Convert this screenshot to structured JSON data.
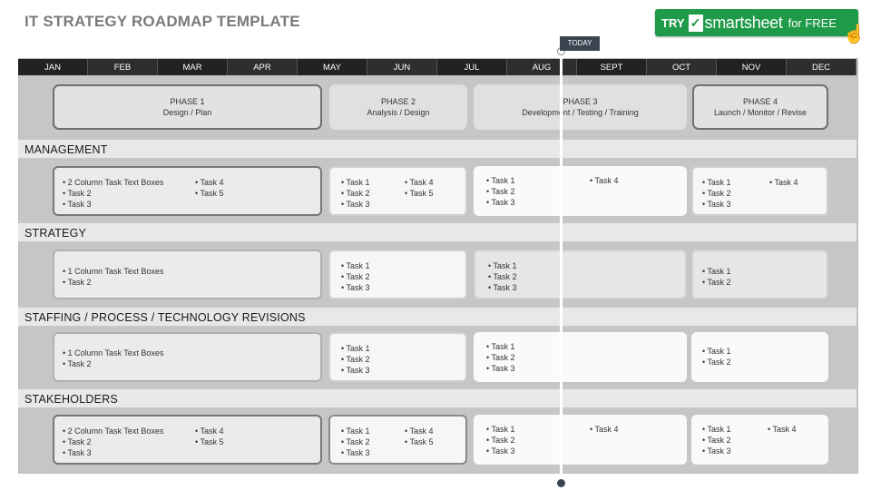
{
  "title": "IT STRATEGY ROADMAP TEMPLATE",
  "promo": {
    "try": "TRY",
    "brand": "smartsheet",
    "free": "for FREE",
    "icon": "pointing-hand-icon"
  },
  "today": "TODAY",
  "months": [
    "JAN",
    "FEB",
    "MAR",
    "APR",
    "MAY",
    "JUN",
    "JUL",
    "AUG",
    "SEPT",
    "OCT",
    "NOV",
    "DEC"
  ],
  "phases": [
    {
      "name": "PHASE 1",
      "desc": "Design / Plan"
    },
    {
      "name": "PHASE 2",
      "desc": "Analysis / Design"
    },
    {
      "name": "PHASE 3",
      "desc": "Development / Testing / Training"
    },
    {
      "name": "PHASE 4",
      "desc": "Launch / Monitor / Revise"
    }
  ],
  "sections": [
    {
      "label": "MANAGEMENT",
      "cards": [
        {
          "cols": [
            [
              "• 2 Column Task Text Boxes",
              "• Task 2",
              "• Task 3"
            ],
            [
              "• Task 4",
              "• Task 5"
            ]
          ]
        },
        {
          "cols": [
            [
              "• Task 1",
              "• Task 2",
              "• Task 3"
            ],
            [
              "• Task 4",
              "• Task 5"
            ]
          ]
        },
        {
          "cols": [
            [
              "• Task 1",
              "• Task 2",
              "• Task 3"
            ],
            [
              "• Task 4"
            ]
          ]
        },
        {
          "cols": [
            [
              "• Task 1",
              "• Task 2",
              "• Task 3"
            ],
            [
              "• Task 4"
            ]
          ]
        }
      ]
    },
    {
      "label": "STRATEGY",
      "cards": [
        {
          "cols": [
            [
              "• 1 Column Task Text Boxes",
              "• Task 2"
            ]
          ]
        },
        {
          "cols": [
            [
              "• Task 1",
              "• Task 2",
              "• Task 3"
            ]
          ]
        },
        {
          "cols": [
            [
              "• Task 1",
              "• Task 2",
              "• Task 3"
            ]
          ]
        },
        {
          "cols": [
            [
              "• Task 1",
              "• Task 2"
            ]
          ]
        }
      ]
    },
    {
      "label": "STAFFING / PROCESS / TECHNOLOGY REVISIONS",
      "cards": [
        {
          "cols": [
            [
              "• 1 Column Task Text Boxes",
              "• Task 2"
            ]
          ]
        },
        {
          "cols": [
            [
              "• Task 1",
              "• Task 2",
              "• Task 3"
            ]
          ]
        },
        {
          "cols": [
            [
              "• Task 1",
              "• Task 2",
              "• Task 3"
            ]
          ]
        },
        {
          "cols": [
            [
              "• Task 1",
              "• Task 2"
            ]
          ]
        }
      ]
    },
    {
      "label": "STAKEHOLDERS",
      "cards": [
        {
          "cols": [
            [
              "• 2 Column Task Text Boxes",
              "• Task 2",
              "• Task 3"
            ],
            [
              "• Task 4",
              "• Task 5"
            ]
          ]
        },
        {
          "cols": [
            [
              "• Task 1",
              "• Task 2",
              "• Task 3"
            ],
            [
              "• Task 4",
              "• Task 5"
            ]
          ]
        },
        {
          "cols": [
            [
              "• Task 1",
              "• Task 2",
              "• Task 3"
            ],
            [
              "• Task 4"
            ]
          ]
        },
        {
          "cols": [
            [
              "• Task 1",
              "• Task 2",
              "• Task 3"
            ],
            [
              "• Task 4"
            ]
          ]
        }
      ]
    }
  ]
}
